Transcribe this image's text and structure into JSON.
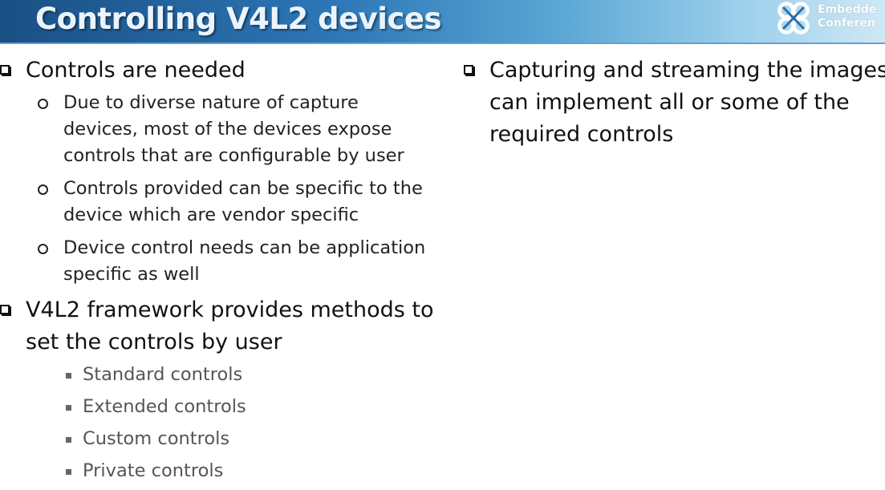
{
  "slide": {
    "title": "Controlling V4L2 devices",
    "logo": {
      "line1": "Embedde",
      "line2": "Conferen",
      "line3": "·  ·  ·  ·  ·  ·  ·  ·  ·"
    },
    "left_column": {
      "item1": {
        "text": "Controls are needed",
        "subitems": [
          {
            "lines": [
              "Due to diverse nature of capture",
              "devices, most of the devices expose",
              "controls that are configurable by user"
            ]
          },
          {
            "lines": [
              "Controls provided can be specific to the",
              "device which are vendor specific"
            ]
          },
          {
            "lines": [
              "Device control needs can be application",
              "specific as well"
            ]
          }
        ]
      },
      "item2": {
        "lines": [
          "V4L2 framework provides methods to",
          "set the controls by user"
        ],
        "subitems": [
          "Standard controls",
          "Extended controls",
          "Custom controls",
          "Private controls"
        ]
      }
    },
    "right_column": {
      "item1": {
        "lines": [
          "Capturing and streaming the images",
          "can implement all or some of the",
          "required controls"
        ]
      }
    }
  },
  "colors": {
    "header_dark": "#1a4f84",
    "header_light": "#cfe8f5",
    "title_text": "#eaf4fc",
    "body_text": "#111111"
  },
  "icons": {
    "level1_bullet": "hollow-square-bullet-icon",
    "level2_bullet": "hollow-circle-bullet-icon",
    "level3_bullet": "filled-square-bullet-icon",
    "logo": "embedded-conference-logo-icon"
  }
}
